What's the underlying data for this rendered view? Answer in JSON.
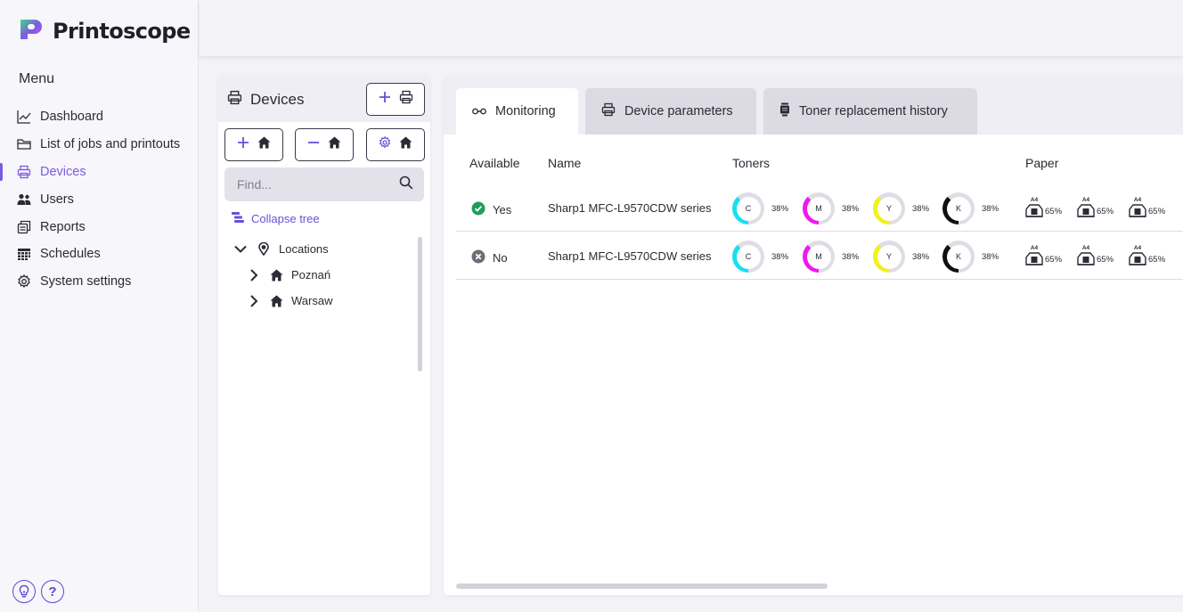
{
  "app": {
    "name": "Printoscope"
  },
  "sidebar": {
    "menu_title": "Menu",
    "items": [
      {
        "label": "Dashboard",
        "icon": "chart-line-icon",
        "active": false
      },
      {
        "label": "List of jobs and printouts",
        "icon": "folder-icon",
        "active": false
      },
      {
        "label": "Devices",
        "icon": "printer-icon",
        "active": true
      },
      {
        "label": "Users",
        "icon": "users-icon",
        "active": false
      },
      {
        "label": "Reports",
        "icon": "reports-icon",
        "active": false
      },
      {
        "label": "Schedules",
        "icon": "calendar-icon",
        "active": false
      },
      {
        "label": "System settings",
        "icon": "gear-icon",
        "active": false
      }
    ],
    "help": {
      "tips_icon": "lightbulb-icon",
      "help_icon": "question-icon",
      "help_label": "?"
    }
  },
  "devices_panel": {
    "title": "Devices",
    "search_placeholder": "Find...",
    "collapse_label": "Collapse tree",
    "tree": [
      {
        "label": "Locations",
        "expanded": true,
        "icon": "location-pin-icon"
      },
      {
        "label": "Poznań",
        "expanded": false,
        "icon": "home-icon"
      },
      {
        "label": "Warsaw",
        "expanded": false,
        "icon": "home-icon"
      }
    ]
  },
  "tabs": [
    {
      "label": "Monitoring",
      "icon": "glasses-icon",
      "active": true
    },
    {
      "label": "Device parameters",
      "icon": "printer-icon",
      "active": false
    },
    {
      "label": "Toner replacement history",
      "icon": "toner-icon",
      "active": false
    }
  ],
  "table": {
    "headers": {
      "available": "Available",
      "name": "Name",
      "toners": "Toners",
      "paper": "Paper"
    },
    "rows": [
      {
        "available": "Yes",
        "status": "ok",
        "name": "Sharp1 MFC-L9570CDW series",
        "toners": [
          {
            "label": "C",
            "percent": "38%",
            "level": 38,
            "color": "#16e0f0"
          },
          {
            "label": "M",
            "percent": "38%",
            "level": 38,
            "color": "#ee18ee"
          },
          {
            "label": "Y",
            "percent": "38%",
            "level": 38,
            "color": "#f4f01a"
          },
          {
            "label": "K",
            "percent": "38%",
            "level": 38,
            "color": "#111111"
          }
        ],
        "paper": [
          {
            "size": "A4",
            "tray": "1",
            "percent": "65%"
          },
          {
            "size": "A4",
            "tray": "1",
            "percent": "65%"
          },
          {
            "size": "A4",
            "tray": "1",
            "percent": "65%"
          }
        ]
      },
      {
        "available": "No",
        "status": "unavailable",
        "name": "Sharp1 MFC-L9570CDW series",
        "toners": [
          {
            "label": "C",
            "percent": "38%",
            "level": 38,
            "color": "#16e0f0"
          },
          {
            "label": "M",
            "percent": "38%",
            "level": 38,
            "color": "#ee18ee"
          },
          {
            "label": "Y",
            "percent": "38%",
            "level": 38,
            "color": "#f4f01a"
          },
          {
            "label": "K",
            "percent": "38%",
            "level": 38,
            "color": "#111111"
          }
        ],
        "paper": [
          {
            "size": "A4",
            "tray": "1",
            "percent": "65%"
          },
          {
            "size": "A4",
            "tray": "1",
            "percent": "65%"
          },
          {
            "size": "A4",
            "tray": "1",
            "percent": "65%"
          }
        ]
      }
    ]
  },
  "colors": {
    "accent": "#7b5ce0",
    "ok": "#1f9e55",
    "unavailable": "#6c6c78",
    "ring_track": "#dedde4"
  }
}
